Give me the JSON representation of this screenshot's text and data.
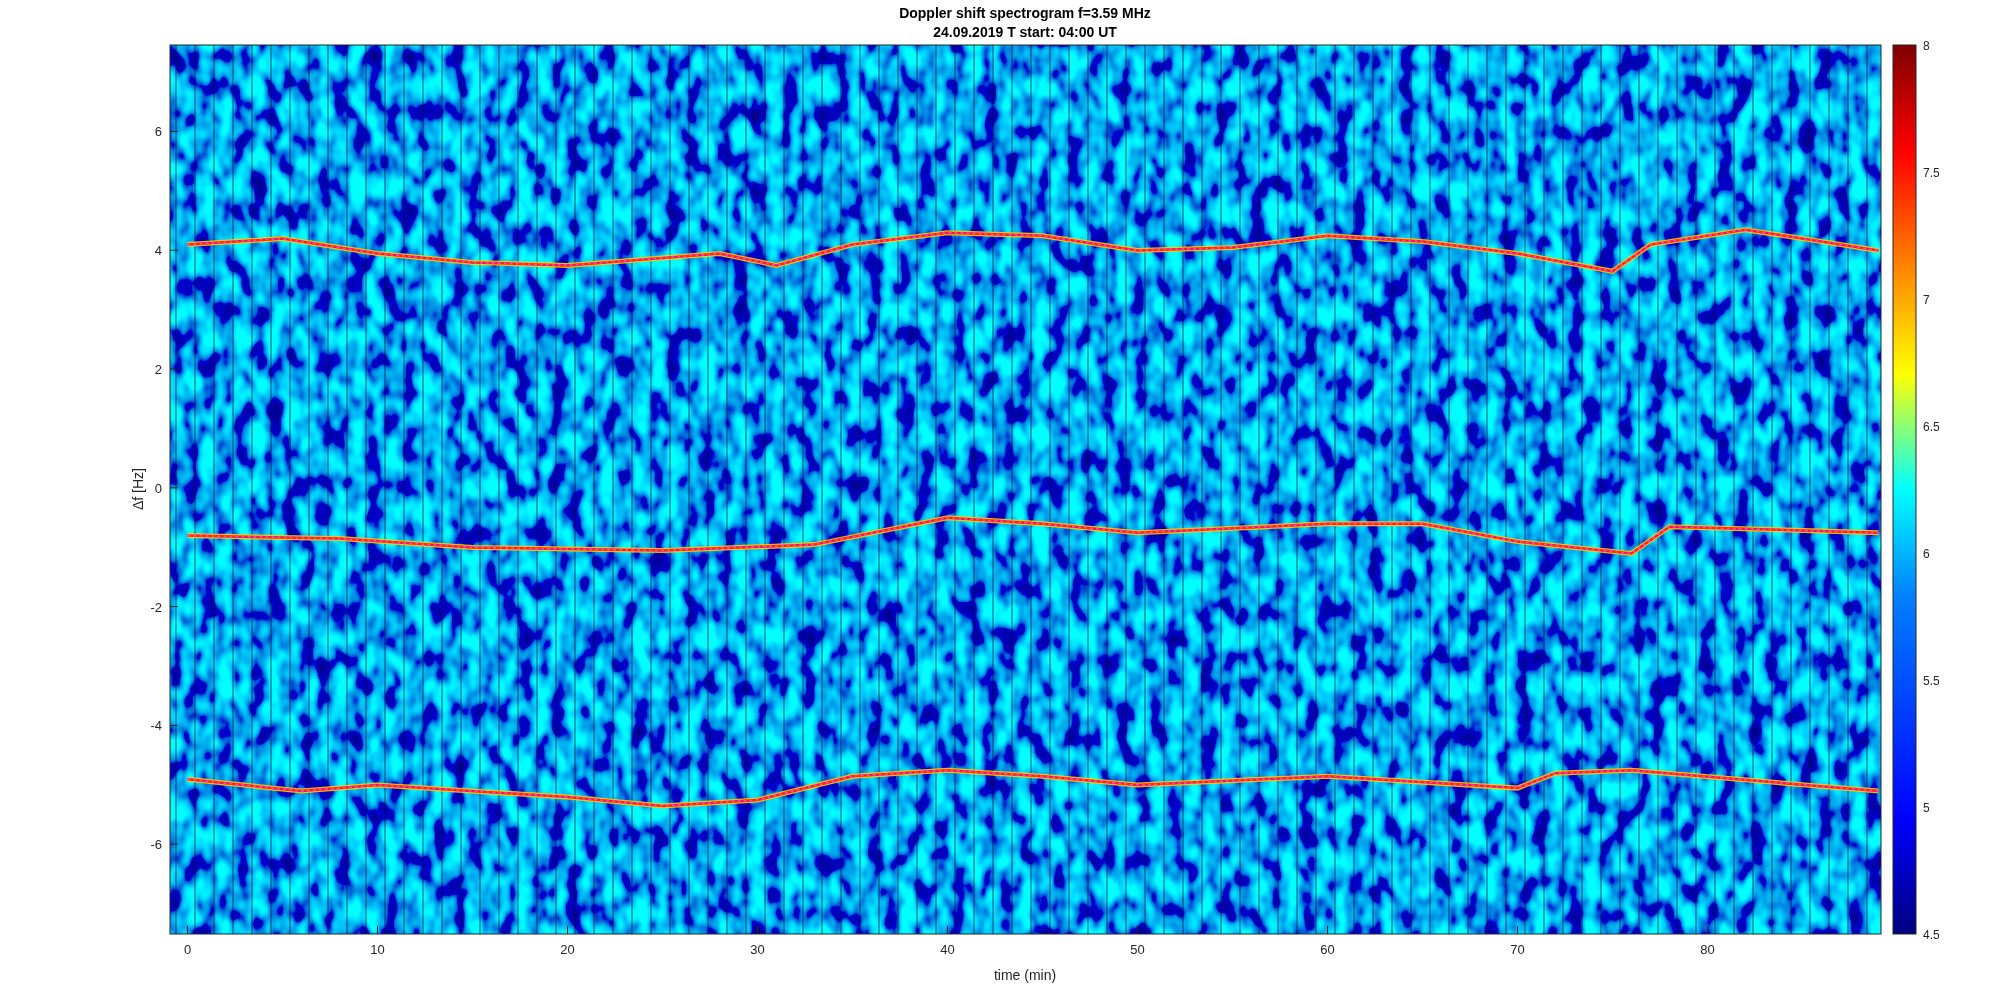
{
  "figure": {
    "title": "Doppler shift spectrogram f=3.59 MHz",
    "subtitle": "24.09.2019   T start: 04:00 UT",
    "xlabel": "time (min)",
    "ylabel": "Δf [Hz]",
    "xticks": [
      "0",
      "10",
      "20",
      "30",
      "40",
      "50",
      "60",
      "70",
      "80"
    ],
    "yticks": [
      "6",
      "4",
      "2",
      "0",
      "-2",
      "-4",
      "-6"
    ],
    "colorbar_ticks": [
      "8",
      "7.5",
      "7",
      "6.5",
      "6",
      "5.5",
      "5",
      "4.5"
    ]
  }
}
